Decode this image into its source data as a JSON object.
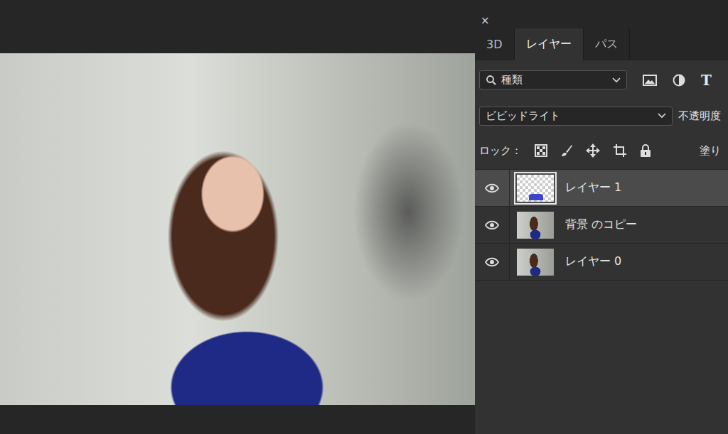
{
  "panel": {
    "close": "×"
  },
  "tabs": [
    {
      "label": "3D",
      "selected": false
    },
    {
      "label": "レイヤー",
      "selected": true
    },
    {
      "label": "パス",
      "selected": false
    }
  ],
  "filter": {
    "value": "種類",
    "type_icon": "T"
  },
  "blend": {
    "mode": "ビビッドライト",
    "opacity_label": "不透明度"
  },
  "lock": {
    "label": "ロック：",
    "fill_label": "塗り"
  },
  "layers": [
    {
      "name": "レイヤー 1",
      "visible": true,
      "selected": true,
      "kind": "transparent"
    },
    {
      "name": "背景 のコピー",
      "visible": true,
      "selected": false,
      "kind": "photo"
    },
    {
      "name": "レイヤー 0",
      "visible": true,
      "selected": false,
      "kind": "photo"
    }
  ]
}
